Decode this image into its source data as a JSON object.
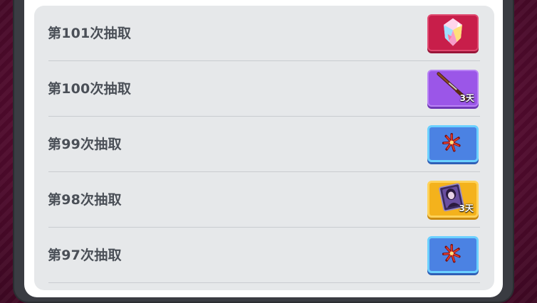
{
  "draws": [
    {
      "label": "第101次抽取",
      "reward_icon": "crystal-icon",
      "rarity_color": "#c81e4a",
      "duration": ""
    },
    {
      "label": "第100次抽取",
      "reward_icon": "rifle-icon",
      "rarity_color": "#9b56e8",
      "duration": "3天"
    },
    {
      "label": "第99次抽取",
      "reward_icon": "firework-icon",
      "rarity_color": "#4b82e3",
      "duration": ""
    },
    {
      "label": "第98次抽取",
      "reward_icon": "portrait-card-icon",
      "rarity_color": "#f4b21c",
      "duration": "3天"
    },
    {
      "label": "第97次抽取",
      "reward_icon": "firework-icon",
      "rarity_color": "#4b82e3",
      "duration": ""
    }
  ]
}
